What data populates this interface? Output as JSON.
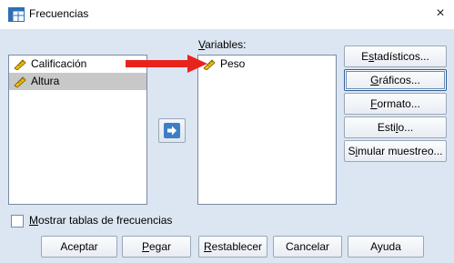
{
  "window": {
    "title": "Frecuencias",
    "close_label": "×"
  },
  "source_list": {
    "items": [
      {
        "label": "Calificación",
        "icon": "ruler-icon",
        "selected": false
      },
      {
        "label": "Altura",
        "icon": "ruler-icon",
        "selected": true
      }
    ]
  },
  "variables": {
    "label_accel": "V",
    "label_rest": "ariables:",
    "items": [
      {
        "label": "Peso",
        "icon": "ruler-icon"
      }
    ]
  },
  "move_button": {
    "icon": "arrow-right-icon"
  },
  "side_buttons": {
    "estadisticos": {
      "pre": "E",
      "accel": "s",
      "post": "tadísticos..."
    },
    "graficos": {
      "pre": "",
      "accel": "G",
      "post": "ráficos..."
    },
    "formato": {
      "pre": "",
      "accel": "F",
      "post": "ormato..."
    },
    "estilo": {
      "pre": "Esti",
      "accel": "l",
      "post": "o..."
    },
    "simular": {
      "pre": "S",
      "accel": "i",
      "post": "mular muestreo..."
    }
  },
  "checkbox": {
    "accel": "M",
    "rest": "ostrar tablas de frecuencias",
    "checked": false
  },
  "bottom_buttons": {
    "aceptar": {
      "pre": "Aceptar",
      "accel": "",
      "post": ""
    },
    "pegar": {
      "pre": "",
      "accel": "P",
      "post": "egar"
    },
    "restablecer": {
      "pre": "",
      "accel": "R",
      "post": "establecer"
    },
    "cancelar": {
      "pre": "Cancelar",
      "accel": "",
      "post": ""
    },
    "ayuda": {
      "pre": "Ayuda",
      "accel": "",
      "post": ""
    }
  },
  "colors": {
    "accent": "#3d7fc6",
    "annotation_arrow": "#e8231e",
    "dialog_bg": "#dce6f2"
  }
}
